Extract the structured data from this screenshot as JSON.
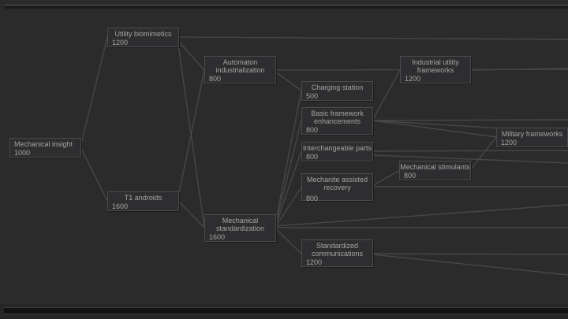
{
  "nodes": [
    {
      "id": "mechanical-insight",
      "name": "Mechanical insight",
      "cost": "1000"
    },
    {
      "id": "utility-biomimetics",
      "name": "Utility biomimetics",
      "cost": "1200"
    },
    {
      "id": "t1-androids",
      "name": "T1 androids",
      "cost": "1600"
    },
    {
      "id": "automaton-industrialization",
      "name": "Automaton industrialization",
      "cost": "800"
    },
    {
      "id": "mechanical-standardization",
      "name": "Mechanical standardization",
      "cost": "1600"
    },
    {
      "id": "charging-station",
      "name": "Charging station",
      "cost": "500"
    },
    {
      "id": "basic-framework-enhancements",
      "name": "Basic framework enhancements",
      "cost": "800"
    },
    {
      "id": "interchangeable-parts",
      "name": "Interchangeable parts",
      "cost": "800"
    },
    {
      "id": "mechanite-assisted-recovery",
      "name": "Mechanite assisted recovery",
      "cost": "800"
    },
    {
      "id": "standardized-communications",
      "name": "Standardized communications",
      "cost": "1200"
    },
    {
      "id": "industrial-utility-frameworks",
      "name": "Industrial utility frameworks",
      "cost": "1200"
    },
    {
      "id": "mechanical-stimulants",
      "name": "Mechanical stimulants",
      "cost": "800"
    },
    {
      "id": "military-frameworks",
      "name": "Military frameworks",
      "cost": "1200"
    }
  ]
}
